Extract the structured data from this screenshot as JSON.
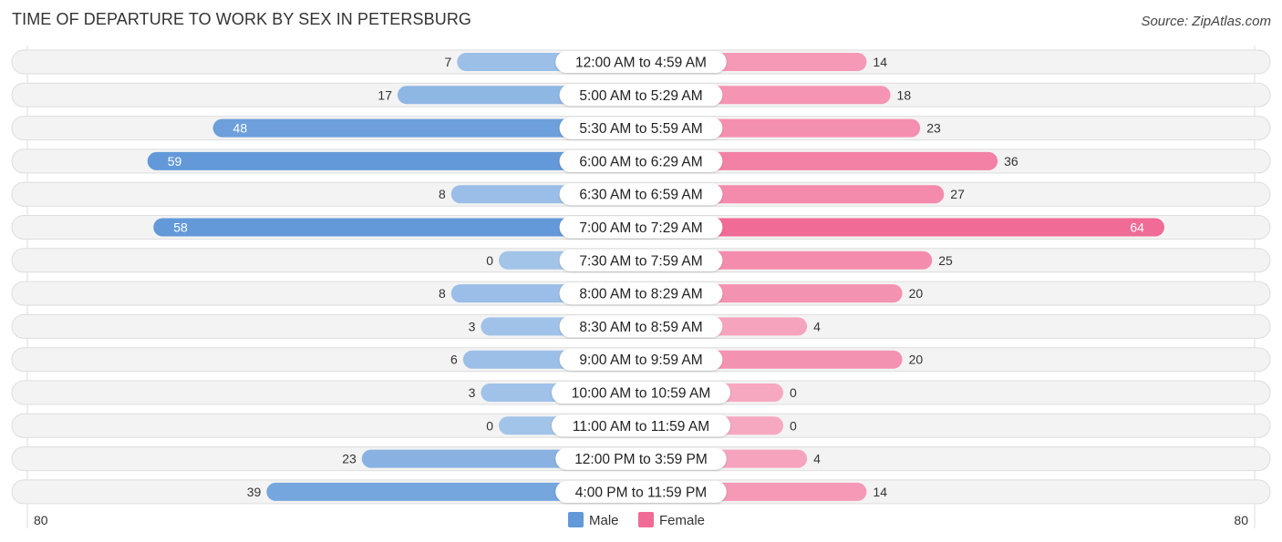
{
  "header": {
    "title": "TIME OF DEPARTURE TO WORK BY SEX IN PETERSBURG",
    "source": "Source: ZipAtlas.com"
  },
  "colors": {
    "male_strong": "#6399d9",
    "male_light": "#a3c4e9",
    "female_strong": "#f06b95",
    "female_light": "#f7a8c1",
    "row_bg": "#f3f3f3"
  },
  "chart_data": {
    "type": "bar",
    "orientation": "horizontal-diverging",
    "title": "TIME OF DEPARTURE TO WORK BY SEX IN PETERSBURG",
    "categories": [
      "12:00 AM to 4:59 AM",
      "5:00 AM to 5:29 AM",
      "5:30 AM to 5:59 AM",
      "6:00 AM to 6:29 AM",
      "6:30 AM to 6:59 AM",
      "7:00 AM to 7:29 AM",
      "7:30 AM to 7:59 AM",
      "8:00 AM to 8:29 AM",
      "8:30 AM to 8:59 AM",
      "9:00 AM to 9:59 AM",
      "10:00 AM to 10:59 AM",
      "11:00 AM to 11:59 AM",
      "12:00 PM to 3:59 PM",
      "4:00 PM to 11:59 PM"
    ],
    "series": [
      {
        "name": "Male",
        "side": "left",
        "values": [
          7,
          17,
          48,
          59,
          8,
          58,
          0,
          8,
          3,
          6,
          3,
          0,
          23,
          39
        ]
      },
      {
        "name": "Female",
        "side": "right",
        "values": [
          14,
          18,
          23,
          36,
          27,
          64,
          25,
          20,
          4,
          20,
          0,
          0,
          4,
          14
        ]
      }
    ],
    "xlim": [
      80,
      80
    ],
    "axis_labels": {
      "left": "80",
      "right": "80"
    },
    "legend": {
      "position": "bottom-center",
      "entries": [
        "Male",
        "Female"
      ]
    },
    "grid": false
  }
}
